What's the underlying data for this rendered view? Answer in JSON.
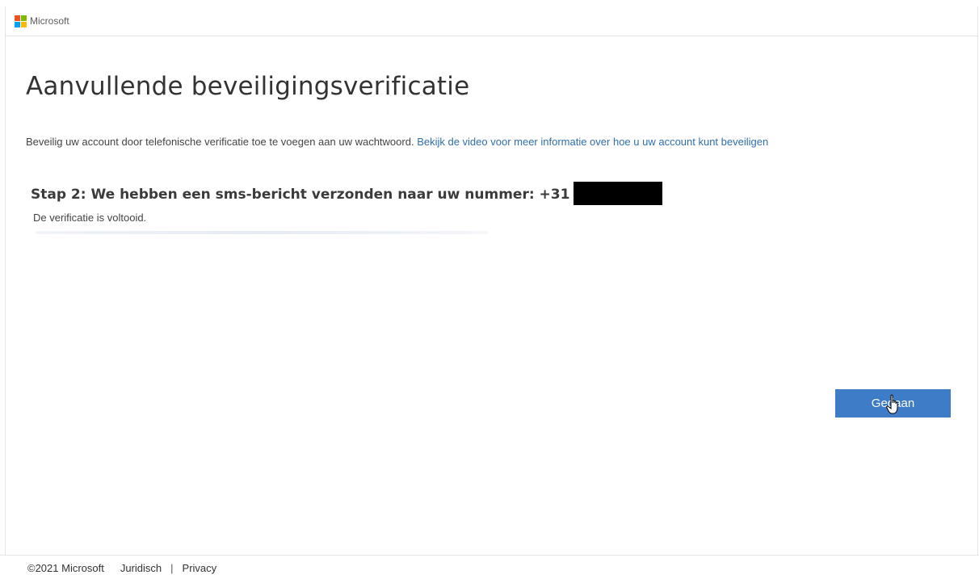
{
  "header": {
    "brand": "Microsoft",
    "logo_colors": [
      "#f25022",
      "#7fba00",
      "#00a4ef",
      "#ffb900"
    ]
  },
  "main": {
    "title": "Aanvullende beveiligingsverificatie",
    "intro_text": "Beveilig uw account door telefonische verificatie toe te voegen aan uw wachtwoord.",
    "intro_link": "Bekijk de video voor meer informatie over hoe u uw account kunt beveiligen",
    "step_heading": "Stap 2: We hebben een sms-bericht verzonden naar uw nummer: +31",
    "status": "De verificatie is voltooid.",
    "done_button": "Gedaan"
  },
  "footer": {
    "copyright": "©2021 Microsoft",
    "legal_link": "Juridisch",
    "separator": "|",
    "privacy_link": "Privacy"
  },
  "colors": {
    "accent": "#3f7cc8",
    "link": "#2f6fb0"
  }
}
